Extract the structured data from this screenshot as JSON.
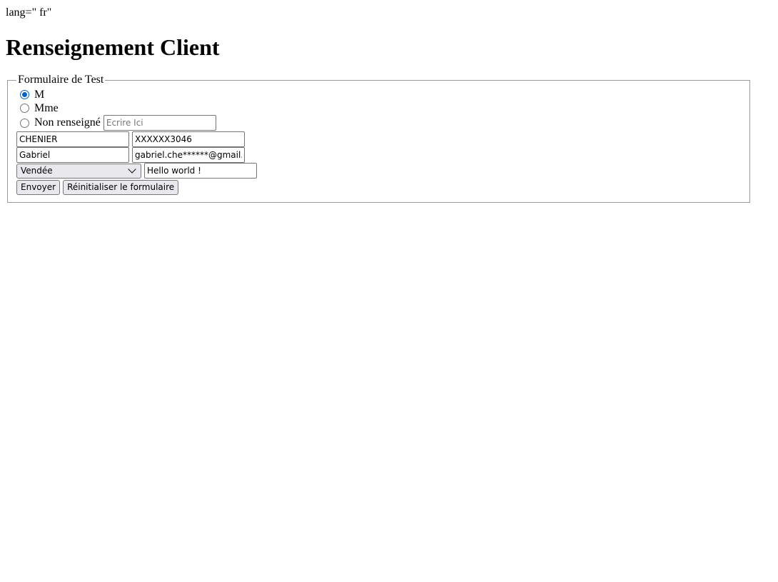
{
  "page": {
    "lang_text": "lang=\" fr\"",
    "title": "Renseignement Client"
  },
  "form": {
    "legend": "Formulaire de Test",
    "civility": [
      {
        "label": "M",
        "checked": true
      },
      {
        "label": "Mme",
        "checked": false
      },
      {
        "label": "Non renseigné",
        "checked": false
      }
    ],
    "other_input_placeholder": "Ecrire Ici",
    "last_name": "CHENIER",
    "phone": "XXXXXX3046",
    "first_name": "Gabriel",
    "email": "gabriel.che******@gmail.com",
    "department_selected": "Vendée",
    "message": "Hello world !",
    "submit_label": "Envoyer",
    "reset_label": "Réinitialiser le formulaire"
  },
  "colors": {
    "accent": "#0060c8",
    "button_bg": "#e9e9ed",
    "border": "#767676"
  }
}
